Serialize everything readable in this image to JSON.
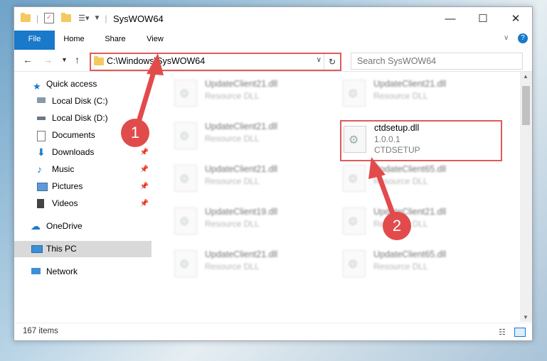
{
  "window": {
    "title": "SysWOW64"
  },
  "ribbon": {
    "tabs": [
      "File",
      "Home",
      "Share",
      "View"
    ]
  },
  "address": {
    "path": "C:\\Windows\\SysWOW64",
    "search_placeholder": "Search SysWOW64"
  },
  "sidebar": {
    "items": [
      {
        "label": "Quick access"
      },
      {
        "label": "Local Disk (C:)"
      },
      {
        "label": "Local Disk (D:)"
      },
      {
        "label": "Documents"
      },
      {
        "label": "Downloads"
      },
      {
        "label": "Music"
      },
      {
        "label": "Pictures"
      },
      {
        "label": "Videos"
      },
      {
        "label": "OneDrive"
      },
      {
        "label": "This PC"
      },
      {
        "label": "Network"
      }
    ]
  },
  "files": [
    {
      "name": "UpdateClient21.dll",
      "desc": "Resource DLL"
    },
    {
      "name": "UpdateClient21.dll",
      "desc": "Resource DLL"
    },
    {
      "name": "UpdateClient21.dll",
      "desc": "Resource DLL"
    },
    {
      "name": "ctdsetup.dll",
      "version": "1.0.0.1",
      "desc": "CTDSETUP"
    },
    {
      "name": "UpdateClient21.dll",
      "desc": "Resource DLL"
    },
    {
      "name": "UpdateClient65.dll",
      "desc": "Resource DLL"
    },
    {
      "name": "UpdateClient19.dll",
      "desc": "Resource DLL"
    },
    {
      "name": "UpdateClient21.dll",
      "desc": "Resource DLL"
    },
    {
      "name": "UpdateClient21.dll",
      "desc": "Resource DLL"
    },
    {
      "name": "UpdateClient65.dll",
      "desc": "Resource DLL"
    }
  ],
  "status": {
    "item_count": "167 items"
  },
  "annotations": {
    "badge1": "1",
    "badge2": "2",
    "accent": "#e24b4b"
  }
}
